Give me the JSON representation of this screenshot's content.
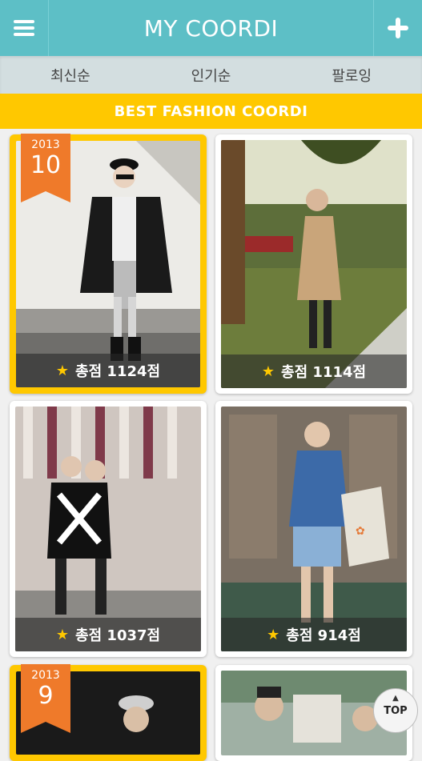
{
  "header": {
    "title": "MY COORDI",
    "menu_icon": "hamburger-icon",
    "add_icon": "plus-icon"
  },
  "tabs": [
    {
      "label": "최신순"
    },
    {
      "label": "인기순"
    },
    {
      "label": "팔로잉"
    }
  ],
  "banner": {
    "label": "BEST FASHION COORDI"
  },
  "cards": [
    {
      "score": "총점 1124점",
      "featured": true,
      "ribbon_year": "2013",
      "ribbon_month": "10"
    },
    {
      "score": "총점 1114점",
      "featured": false
    },
    {
      "score": "총점 1037점",
      "featured": false
    },
    {
      "score": "총점 914점",
      "featured": false
    },
    {
      "featured": true,
      "ribbon_year": "2013",
      "ribbon_month": "9"
    },
    {
      "featured": false
    }
  ],
  "top_button": {
    "label": "TOP"
  },
  "colors": {
    "header": "#5dbfc6",
    "accent": "#ffc800",
    "ribbon": "#ef7a2a",
    "tabs_bg": "#d3dee0"
  }
}
